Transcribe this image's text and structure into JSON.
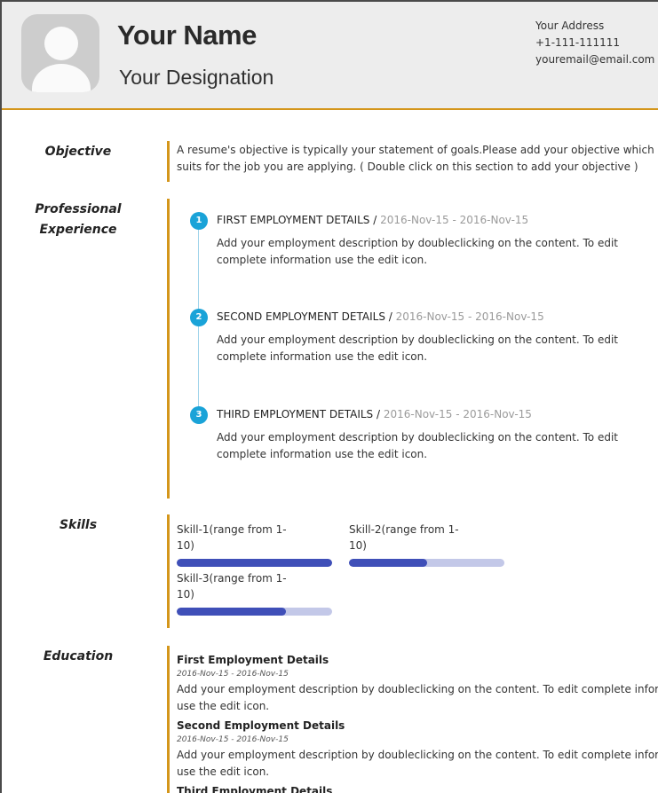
{
  "header": {
    "name": "Your Name",
    "designation": "Your Designation",
    "address": "Your Address",
    "phone": "+1-111-111111",
    "email": "youremail@email.com",
    "avatar_icon": "user-avatar-icon",
    "accent_color": "#d4961b"
  },
  "sections": {
    "objective": "Objective",
    "experience_line1": "Professional",
    "experience_line2": "Experience",
    "skills": "Skills",
    "education": "Education"
  },
  "objective": {
    "text": "A resume's objective is typically your statement of goals.Please add your objective which suits for the job you are applying. ( Double click on this section to add your objective )"
  },
  "experience": [
    {
      "num": "1",
      "title": "FIRST EMPLOYMENT DETAILS",
      "sep": " / ",
      "date": "2016-Nov-15 - 2016-Nov-15",
      "desc": "Add your employment description by doubleclicking on the content. To edit complete information use the edit icon."
    },
    {
      "num": "2",
      "title": "SECOND EMPLOYMENT DETAILS",
      "sep": " / ",
      "date": "2016-Nov-15 - 2016-Nov-15",
      "desc": "Add your employment description by doubleclicking on the content. To edit complete information use the edit icon."
    },
    {
      "num": "3",
      "title": "THIRD EMPLOYMENT DETAILS",
      "sep": " / ",
      "date": "2016-Nov-15 - 2016-Nov-15",
      "desc": "Add your employment description by doubleclicking on the content. To edit complete information use the edit icon."
    }
  ],
  "skills": [
    {
      "label": "Skill-1(range from 1-10)",
      "level": 1.0
    },
    {
      "label": "Skill-2(range from 1-10)",
      "level": 0.5
    },
    {
      "label": "Skill-3(range from 1-10)",
      "level": 0.7
    }
  ],
  "education": [
    {
      "title": "First Employment Details",
      "date": "2016-Nov-15 - 2016-Nov-15",
      "desc_line1": "Add your employment description by doubleclicking on the content. To edit complete information",
      "desc_line2": "use the edit icon."
    },
    {
      "title": "Second Employment Details",
      "date": "2016-Nov-15 - 2016-Nov-15",
      "desc_line1": "Add your employment description by doubleclicking on the content. To edit complete information",
      "desc_line2": "use the edit icon."
    },
    {
      "title": "Third Employment Details"
    }
  ]
}
